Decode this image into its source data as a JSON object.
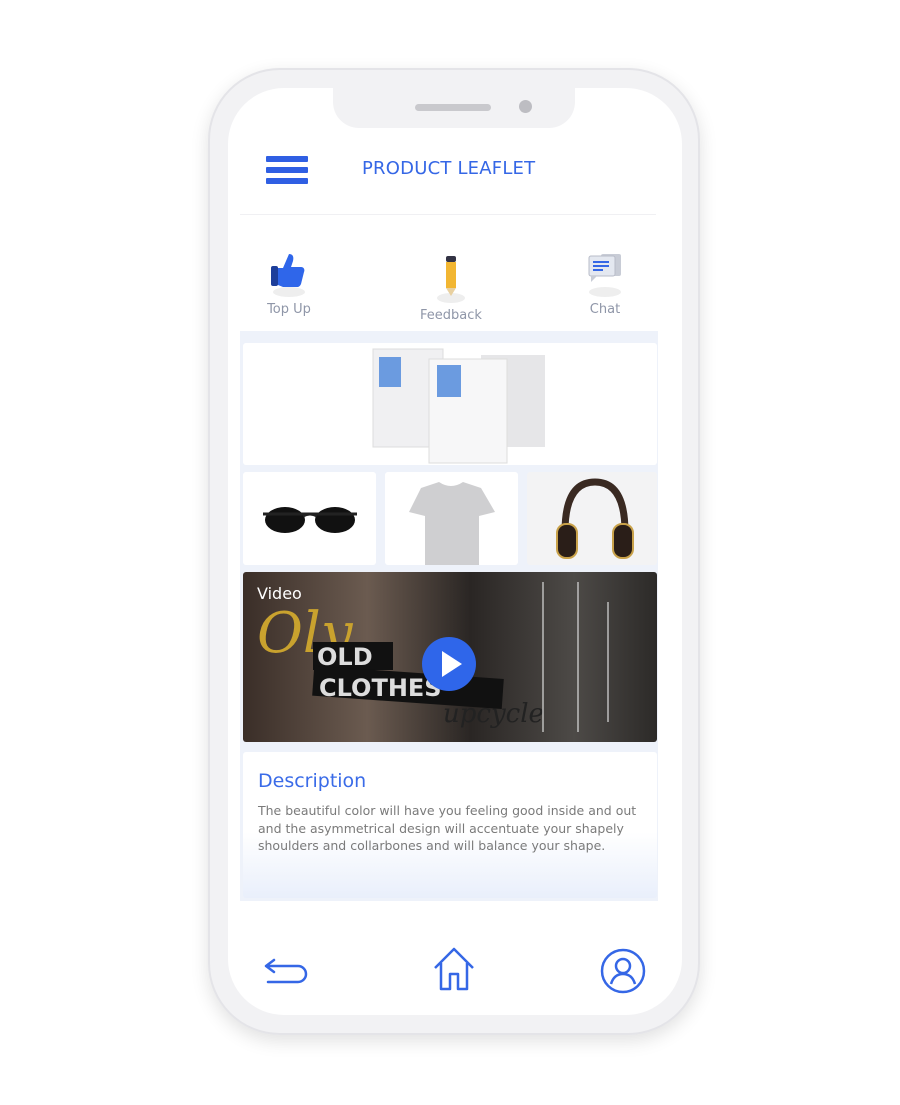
{
  "header": {
    "title": "PRODUCT LEAFLET",
    "menu_icon": "hamburger-icon"
  },
  "quick_actions": [
    {
      "label": "Top Up",
      "icon": "thumbs-up-icon"
    },
    {
      "label": "Feedback",
      "icon": "pencil-icon"
    },
    {
      "label": "Chat",
      "icon": "chat-bubbles-icon"
    }
  ],
  "products": [
    "leaflet-boxes",
    "sunglasses",
    "t-shirt",
    "headphones"
  ],
  "video": {
    "label": "Video",
    "icon": "play-icon"
  },
  "description": {
    "title": "Description",
    "text": "The beautiful color will have you feeling good inside and out and the asymmetrical design will accentuate your shapely shoulders and collarbones and will balance your shape."
  },
  "bottom_nav": [
    {
      "icon": "back-arrow-icon"
    },
    {
      "icon": "home-icon"
    },
    {
      "icon": "user-profile-icon"
    }
  ],
  "colors": {
    "accent": "#3567e6",
    "muted_text": "#8f96a8"
  }
}
